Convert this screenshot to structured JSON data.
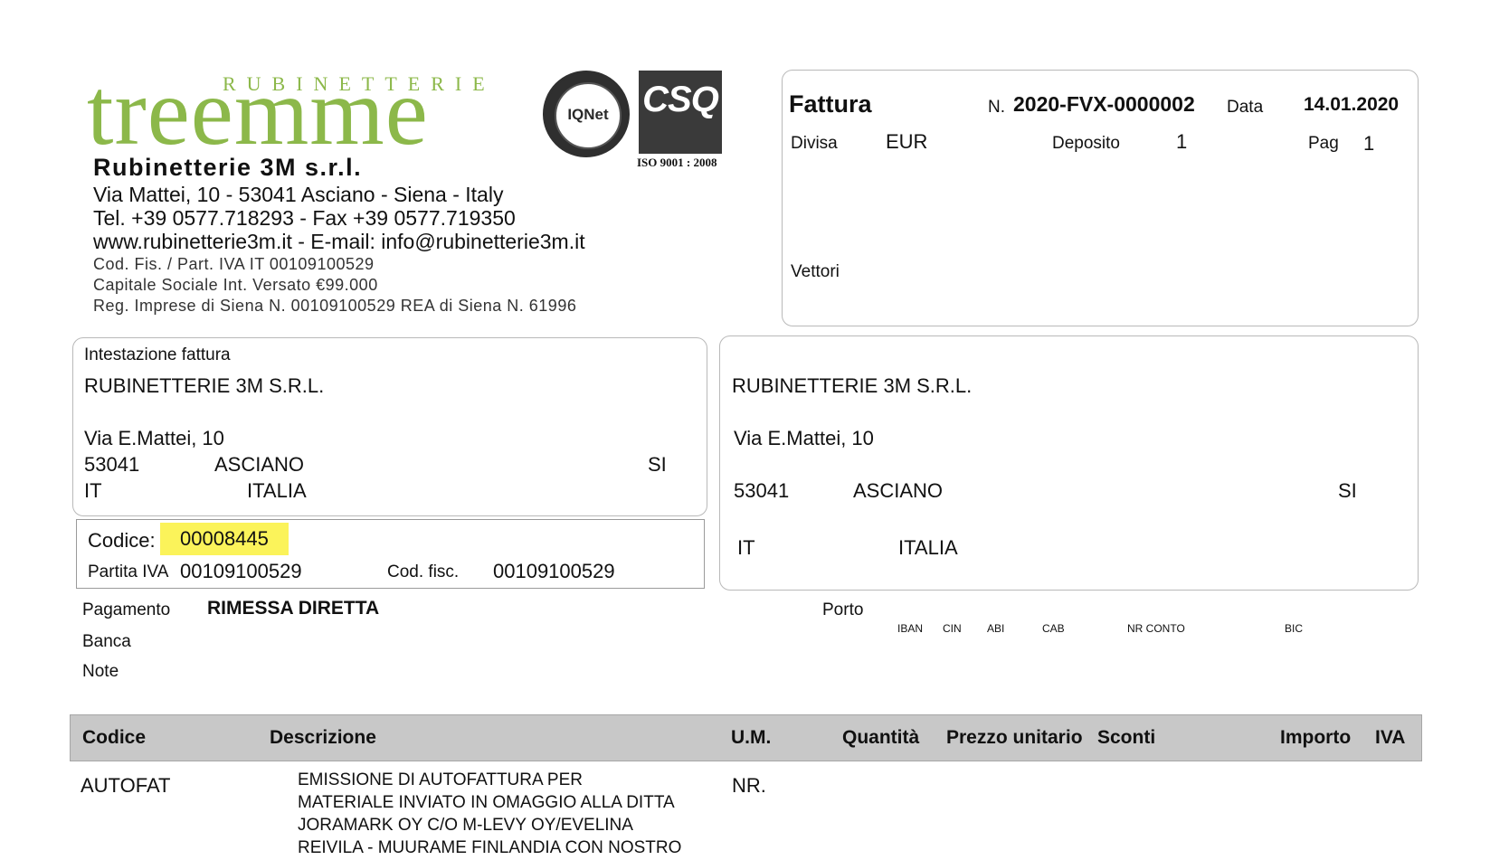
{
  "company": {
    "logo_top": "RUBINETTERIE",
    "logo_main": "treemme",
    "name": "Rubinetterie 3M s.r.l.",
    "address": "Via Mattei, 10 - 53041 Asciano - Siena - Italy",
    "phone": "Tel. +39 0577.718293 - Fax +39 0577.719350",
    "web": "www.rubinetterie3m.it - E-mail: info@rubinetterie3m.it",
    "tax": "Cod. Fis. / Part. IVA IT 00109100529",
    "capital": "Capitale Sociale Int. Versato €99.000",
    "registry": "Reg. Imprese di Siena N. 00109100529 REA di Siena N. 61996",
    "cert1": "IQNet",
    "cert2": "CSQ",
    "iso": "ISO 9001 : 2008"
  },
  "invoice": {
    "title": "Fattura",
    "number_label": "N.",
    "number": "2020-FVX-0000002",
    "date_label": "Data",
    "date": "14.01.2020",
    "currency_label": "Divisa",
    "currency": "EUR",
    "deposit_label": "Deposito",
    "deposit": "1",
    "page_label": "Pag",
    "page": "1",
    "carriers_label": "Vettori"
  },
  "billing": {
    "heading": "Intestazione fattura",
    "name": "RUBINETTERIE 3M S.R.L.",
    "street": "Via E.Mattei, 10",
    "zip": "53041",
    "city": "ASCIANO",
    "province": "SI",
    "country_code": "IT",
    "country": "ITALIA"
  },
  "customer": {
    "code_label": "Codice:",
    "code": "00008445",
    "vat_label": "Partita IVA",
    "vat": "00109100529",
    "fiscal_label": "Cod. fisc.",
    "fiscal": "00109100529"
  },
  "shipping": {
    "name": "RUBINETTERIE 3M S.R.L.",
    "street": "Via E.Mattei, 10",
    "zip": "53041",
    "city": "ASCIANO",
    "province": "SI",
    "country_code": "IT",
    "country": "ITALIA"
  },
  "payment": {
    "label": "Pagamento",
    "value": "RIMESSA DIRETTA",
    "bank_label": "Banca",
    "notes_label": "Note",
    "porto_label": "Porto",
    "iban": "IBAN",
    "cin": "CIN",
    "abi": "ABI",
    "cab": "CAB",
    "account": "NR CONTO",
    "bic": "BIC"
  },
  "table": {
    "headers": {
      "code": "Codice",
      "description": "Descrizione",
      "um": "U.M.",
      "qty": "Quantità",
      "unit_price": "Prezzo unitario",
      "discounts": "Sconti",
      "amount": "Importo",
      "vat": "IVA"
    },
    "rows": [
      {
        "code": "AUTOFAT",
        "description": [
          "EMISSIONE DI AUTOFATTURA PER",
          "MATERIALE INVIATO IN OMAGGIO ALLA DITTA",
          "JORAMARK OY C/O M-LEVY OY/EVELINA",
          "REIVILA - MUURAME FINLANDIA CON NOSTRO"
        ],
        "um": "NR."
      }
    ]
  }
}
